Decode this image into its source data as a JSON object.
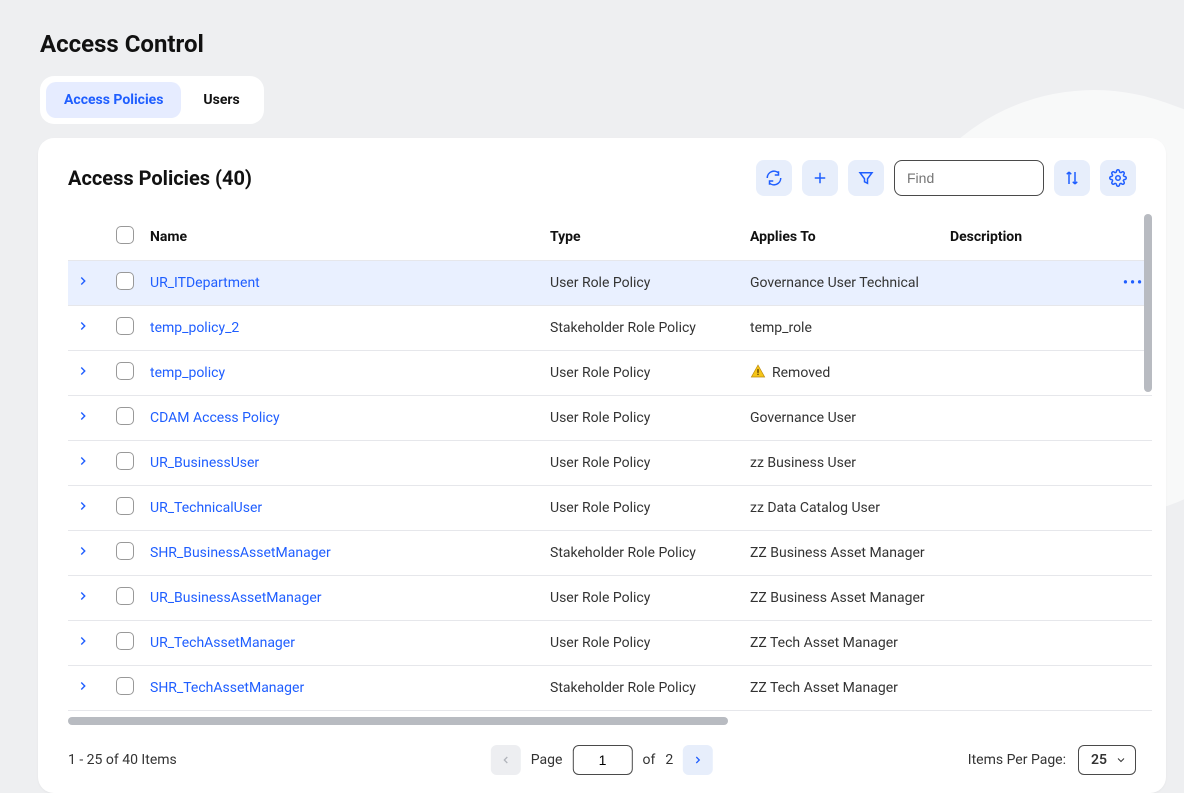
{
  "page": {
    "title": "Access Control"
  },
  "tabs": [
    {
      "label": "Access Policies",
      "active": true
    },
    {
      "label": "Users",
      "active": false
    }
  ],
  "panel": {
    "title": "Access Policies (40)",
    "total": 40
  },
  "toolbar": {
    "find_placeholder": "Find"
  },
  "columns": {
    "name": "Name",
    "type": "Type",
    "applies_to": "Applies To",
    "description": "Description"
  },
  "rows": [
    {
      "name": "UR_ITDepartment",
      "type": "User Role Policy",
      "applies_to": "Governance User Technical",
      "removed": false,
      "selected": true
    },
    {
      "name": "temp_policy_2",
      "type": "Stakeholder Role Policy",
      "applies_to": "temp_role",
      "removed": false,
      "selected": false
    },
    {
      "name": "temp_policy",
      "type": "User Role Policy",
      "applies_to": "Removed",
      "removed": true,
      "selected": false
    },
    {
      "name": "CDAM Access Policy",
      "type": "User Role Policy",
      "applies_to": "Governance User",
      "removed": false,
      "selected": false
    },
    {
      "name": "UR_BusinessUser",
      "type": "User Role Policy",
      "applies_to": "zz Business User",
      "removed": false,
      "selected": false
    },
    {
      "name": "UR_TechnicalUser",
      "type": "User Role Policy",
      "applies_to": "zz Data Catalog User",
      "removed": false,
      "selected": false
    },
    {
      "name": "SHR_BusinessAssetManager",
      "type": "Stakeholder Role Policy",
      "applies_to": "ZZ Business Asset Manager",
      "removed": false,
      "selected": false
    },
    {
      "name": "UR_BusinessAssetManager",
      "type": "User Role Policy",
      "applies_to": "ZZ Business Asset Manager",
      "removed": false,
      "selected": false
    },
    {
      "name": "UR_TechAssetManager",
      "type": "User Role Policy",
      "applies_to": "ZZ Tech Asset Manager",
      "removed": false,
      "selected": false
    },
    {
      "name": "SHR_TechAssetManager",
      "type": "Stakeholder Role Policy",
      "applies_to": "ZZ Tech Asset Manager",
      "removed": false,
      "selected": false
    }
  ],
  "pagination": {
    "range_text": "1 - 25 of 40 Items",
    "page_label": "Page",
    "current_page": "1",
    "of_label": "of",
    "total_pages": "2",
    "ipp_label": "Items Per Page:",
    "ipp_value": "25"
  }
}
